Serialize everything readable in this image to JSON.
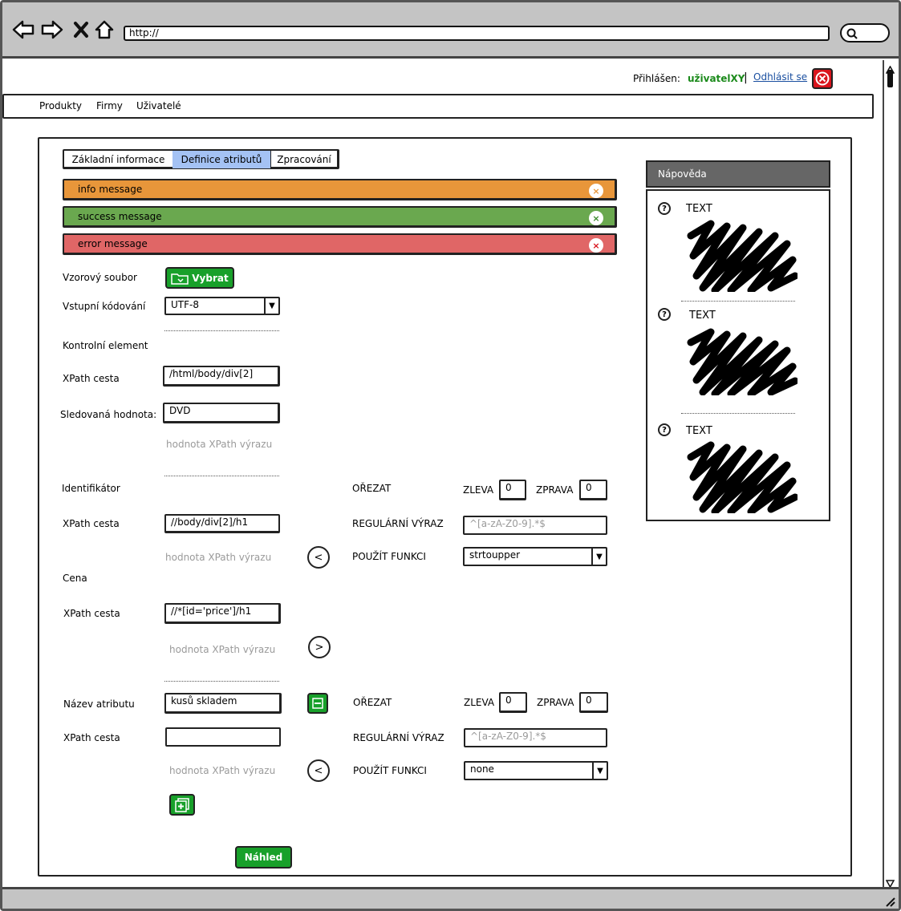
{
  "browser": {
    "url": "http://"
  },
  "header": {
    "logged_in_label": "Přihlášen:",
    "username": "uživatelXY",
    "separator": "|",
    "logout_label": "Odhlásit se"
  },
  "menu": {
    "items": [
      "Produkty",
      "Firmy",
      "Uživatelé"
    ]
  },
  "tabs": [
    {
      "label": "Základní informace",
      "active": false
    },
    {
      "label": "Definice atributů",
      "active": true
    },
    {
      "label": "Zpracování",
      "active": false
    }
  ],
  "messages": {
    "info": "info message",
    "success": "success message",
    "error": "error message"
  },
  "form": {
    "sample_file_label": "Vzorový soubor",
    "choose_button": "Vybrat",
    "encoding_label": "Vstupní kódování",
    "encoding_value": "UTF-8",
    "control": {
      "section_label": "Kontrolní element",
      "xpath_label": "XPath cesta",
      "xpath_value": "/html/body/div[2]",
      "watched_label": "Sledovaná hodnota:",
      "watched_value": "DVD",
      "result_hint": "hodnota XPath výrazu"
    },
    "identifier": {
      "section_label": "Identifikátor",
      "xpath_label": "XPath cesta",
      "xpath_value": "//body/div[2]/h1",
      "result_hint": "hodnota XPath výrazu",
      "arrow": "<",
      "trim_label": "OŘEZAT",
      "left_label": "ZLEVA",
      "left_value": "0",
      "right_label": "ZPRAVA",
      "right_value": "0",
      "regex_label": "REGULÁRNÍ VÝRAZ",
      "regex_placeholder": "^[a-zA-Z0-9].*$",
      "function_label": "POUŽÍT FUNKCI",
      "function_value": "strtoupper"
    },
    "price": {
      "section_label": "Cena",
      "xpath_label": "XPath cesta",
      "xpath_value": "//*[id='price']/h1",
      "result_hint": "hodnota XPath výrazu",
      "arrow": ">"
    },
    "attribute": {
      "name_label": "Název atributu",
      "name_value": "kusů skladem",
      "remove_icon": "minus-icon",
      "xpath_label": "XPath cesta",
      "xpath_value": "",
      "result_hint": "hodnota XPath výrazu",
      "arrow": "<",
      "trim_label": "OŘEZAT",
      "left_label": "ZLEVA",
      "left_value": "0",
      "right_label": "ZPRAVA",
      "right_value": "0",
      "regex_label": "REGULÁRNÍ VÝRAZ",
      "regex_placeholder": "^[a-zA-Z0-9].*$",
      "function_label": "POUŽÍT FUNKCI",
      "function_value": "none"
    },
    "add_icon": "add-icon",
    "preview_button": "Náhled"
  },
  "help": {
    "title": "Nápověda",
    "items": [
      {
        "icon": "question-icon",
        "text": "TEXT"
      },
      {
        "icon": "question-icon",
        "text": "TEXT"
      },
      {
        "icon": "question-icon",
        "text": "TEXT"
      }
    ]
  },
  "colors": {
    "info": "#e8963a",
    "success": "#6aa84f",
    "error": "#e06666",
    "tab_active": "#a4c2f4",
    "green_button": "#18a02a",
    "username": "#1b8a1b",
    "help_header": "#666666"
  }
}
